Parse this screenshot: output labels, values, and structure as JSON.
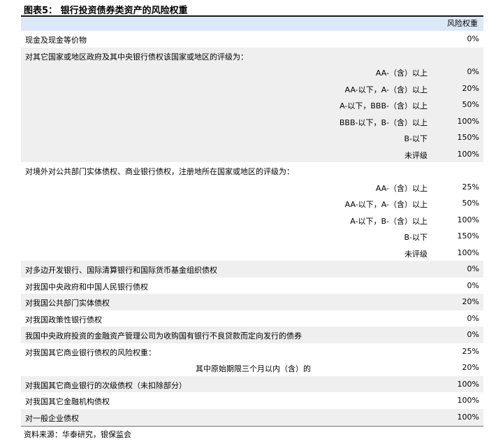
{
  "title": "图表5：  银行投资债券类资产的风险权重",
  "header": {
    "col_label": "风险权重"
  },
  "rows": {
    "r1": {
      "label": "现金及现金等价物",
      "value": "0%"
    },
    "g1_heading": "对其它国家或地区政府及其中央银行债权该国家或地区的评级为：",
    "g1": [
      {
        "sub": "AA-（含）以上",
        "value": "0%"
      },
      {
        "sub": "AA-以下，A-（含）以上",
        "value": "20%"
      },
      {
        "sub": "A-以下，BBB-（含）以上",
        "value": "50%"
      },
      {
        "sub": "BBB-以下，B-（含）以上",
        "value": "100%"
      },
      {
        "sub": "B-以下",
        "value": "150%"
      },
      {
        "sub": "未评级",
        "value": "100%"
      }
    ],
    "g2_heading": "对境外对公共部门实体债权、商业银行债权，注册地所在国家或地区的评级为：",
    "g2": [
      {
        "sub": "AA-（含）以上",
        "value": "25%"
      },
      {
        "sub": "AA-以下，A-（含）以上",
        "value": "50%"
      },
      {
        "sub": "A-以下，B-（含）以上",
        "value": "100%"
      },
      {
        "sub": "B-以下",
        "value": "150%"
      },
      {
        "sub": "未评级",
        "value": "100%"
      }
    ],
    "r2": {
      "label": "对多边开发银行、国际清算银行和国际货币基金组织债权",
      "value": "0%"
    },
    "r3": {
      "label": "对我国中央政府和中国人民银行债权",
      "value": "0%"
    },
    "r4": {
      "label": "对我国公共部门实体债权",
      "value": "20%"
    },
    "r5": {
      "label": "对我国政策性银行债权",
      "value": "0%"
    },
    "r6": {
      "label": "我国中央政府投资的金融资产管理公司为收购国有银行不良贷款而定向发行的债券",
      "value": "0%"
    },
    "r7": {
      "label": "对我国其它商业银行债权的风险权重：",
      "value": "25%"
    },
    "r7b": {
      "label": "其中原始期限三个月以内（含）的",
      "value": "20%"
    },
    "r8": {
      "label": "对我国其它商业银行的次级债权（未扣除部分）",
      "value": "100%"
    },
    "r9": {
      "label": "对我国其它金融机构债权",
      "value": "100%"
    },
    "r10": {
      "label": "对一般企业债权",
      "value": "100%"
    }
  },
  "source": "资料来源：华泰研究，银保监会"
}
